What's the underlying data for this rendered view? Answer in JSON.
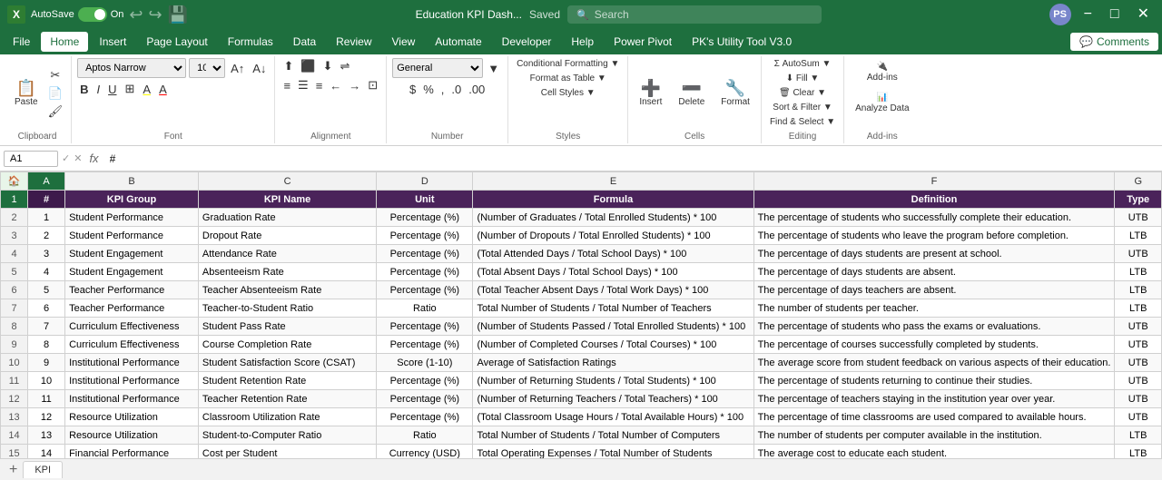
{
  "titleBar": {
    "appName": "Excel",
    "autoSave": "AutoSave",
    "autoSaveOn": "On",
    "fileName": "Education KPI Dash...",
    "saved": "Saved",
    "searchPlaceholder": "Search",
    "userInitials": "PS",
    "minimizeLabel": "−",
    "maximizeLabel": "□",
    "closeLabel": "✕"
  },
  "menuBar": {
    "items": [
      "File",
      "Home",
      "Insert",
      "Page Layout",
      "Formulas",
      "Data",
      "Review",
      "View",
      "Automate",
      "Developer",
      "Help",
      "Power Pivot",
      "PK's Utility Tool V3.0"
    ],
    "activeItem": "Home",
    "commentsLabel": "Comments"
  },
  "ribbon": {
    "clipboard": {
      "label": "Clipboard",
      "paste": "Paste",
      "cut": "Cut",
      "copy": "Copy",
      "formatPainter": "Format Painter"
    },
    "font": {
      "label": "Font",
      "fontName": "Aptos Narrow",
      "fontSize": "10"
    },
    "alignment": {
      "label": "Alignment",
      "wrapText": "Wrap Text",
      "mergeCenter": "Merge & Center"
    },
    "number": {
      "label": "Number"
    },
    "styles": {
      "label": "Styles",
      "conditional": "Conditional Formatting",
      "formatTable": "Format as Table",
      "cellStyles": "Cell Styles"
    },
    "cells": {
      "label": "Cells",
      "insert": "Insert",
      "delete": "Delete",
      "format": "Format"
    },
    "editing": {
      "label": "Editing",
      "autoSum": "AutoSum",
      "fill": "Fill",
      "clear": "Clear",
      "sortFilter": "Sort & Filter",
      "findSelect": "Find & Select"
    },
    "addins": {
      "label": "Add-ins",
      "addins": "Add-ins",
      "analyzeData": "Analyze Data"
    }
  },
  "formulaBar": {
    "cellRef": "A1",
    "formula": "#"
  },
  "columns": {
    "headers": [
      "A",
      "B",
      "C",
      "D",
      "E",
      "F",
      "G"
    ]
  },
  "tableHeaders": {
    "a": "#",
    "b": "KPI Group",
    "c": "KPI Name",
    "d": "Unit",
    "e": "Formula",
    "f": "Definition",
    "g": "Type"
  },
  "rows": [
    {
      "num": "1",
      "a": "1",
      "b": "Student Performance",
      "c": "Graduation Rate",
      "d": "Percentage (%)",
      "e": "(Number of Graduates / Total Enrolled Students) * 100",
      "f": "The percentage of students who successfully complete their education.",
      "g": "UTB"
    },
    {
      "num": "2",
      "a": "2",
      "b": "Student Performance",
      "c": "Dropout Rate",
      "d": "Percentage (%)",
      "e": "(Number of Dropouts / Total Enrolled Students) * 100",
      "f": "The percentage of students who leave the program before completion.",
      "g": "LTB"
    },
    {
      "num": "3",
      "a": "3",
      "b": "Student Engagement",
      "c": "Attendance Rate",
      "d": "Percentage (%)",
      "e": "(Total Attended Days / Total School Days) * 100",
      "f": "The percentage of days students are present at school.",
      "g": "UTB"
    },
    {
      "num": "4",
      "a": "4",
      "b": "Student Engagement",
      "c": "Absenteeism Rate",
      "d": "Percentage (%)",
      "e": "(Total Absent Days / Total School Days) * 100",
      "f": "The percentage of days students are absent.",
      "g": "LTB"
    },
    {
      "num": "5",
      "a": "5",
      "b": "Teacher Performance",
      "c": "Teacher Absenteeism Rate",
      "d": "Percentage (%)",
      "e": "(Total Teacher Absent Days / Total Work Days) * 100",
      "f": "The percentage of days teachers are absent.",
      "g": "LTB"
    },
    {
      "num": "6",
      "a": "6",
      "b": "Teacher Performance",
      "c": "Teacher-to-Student Ratio",
      "d": "Ratio",
      "e": "Total Number of Students / Total Number of Teachers",
      "f": "The number of students per teacher.",
      "g": "LTB"
    },
    {
      "num": "7",
      "a": "7",
      "b": "Curriculum Effectiveness",
      "c": "Student Pass Rate",
      "d": "Percentage (%)",
      "e": "(Number of Students Passed / Total Enrolled Students) * 100",
      "f": "The percentage of students who pass the exams or evaluations.",
      "g": "UTB"
    },
    {
      "num": "8",
      "a": "8",
      "b": "Curriculum Effectiveness",
      "c": "Course Completion Rate",
      "d": "Percentage (%)",
      "e": "(Number of Completed Courses / Total Courses) * 100",
      "f": "The percentage of courses successfully completed by students.",
      "g": "UTB"
    },
    {
      "num": "9",
      "a": "9",
      "b": "Institutional Performance",
      "c": "Student Satisfaction Score (CSAT)",
      "d": "Score (1-10)",
      "e": "Average of Satisfaction Ratings",
      "f": "The average score from student feedback on various aspects of their education.",
      "g": "UTB"
    },
    {
      "num": "10",
      "a": "10",
      "b": "Institutional Performance",
      "c": "Student Retention Rate",
      "d": "Percentage (%)",
      "e": "(Number of Returning Students / Total Students) * 100",
      "f": "The percentage of students returning to continue their studies.",
      "g": "UTB"
    },
    {
      "num": "11",
      "a": "11",
      "b": "Institutional Performance",
      "c": "Teacher Retention Rate",
      "d": "Percentage (%)",
      "e": "(Number of Returning Teachers / Total Teachers) * 100",
      "f": "The percentage of teachers staying in the institution year over year.",
      "g": "UTB"
    },
    {
      "num": "12",
      "a": "12",
      "b": "Resource Utilization",
      "c": "Classroom Utilization Rate",
      "d": "Percentage (%)",
      "e": "(Total Classroom Usage Hours / Total Available Hours) * 100",
      "f": "The percentage of time classrooms are used compared to available hours.",
      "g": "UTB"
    },
    {
      "num": "13",
      "a": "13",
      "b": "Resource Utilization",
      "c": "Student-to-Computer Ratio",
      "d": "Ratio",
      "e": "Total Number of Students / Total Number of Computers",
      "f": "The number of students per computer available in the institution.",
      "g": "LTB"
    },
    {
      "num": "14",
      "a": "14",
      "b": "Financial Performance",
      "c": "Cost per Student",
      "d": "Currency (USD)",
      "e": "Total Operating Expenses / Total Number of Students",
      "f": "The average cost to educate each student.",
      "g": "LTB"
    }
  ],
  "emptyRow": {
    "num": "15"
  },
  "sheetTab": {
    "label": "KPI",
    "addLabel": "+"
  }
}
